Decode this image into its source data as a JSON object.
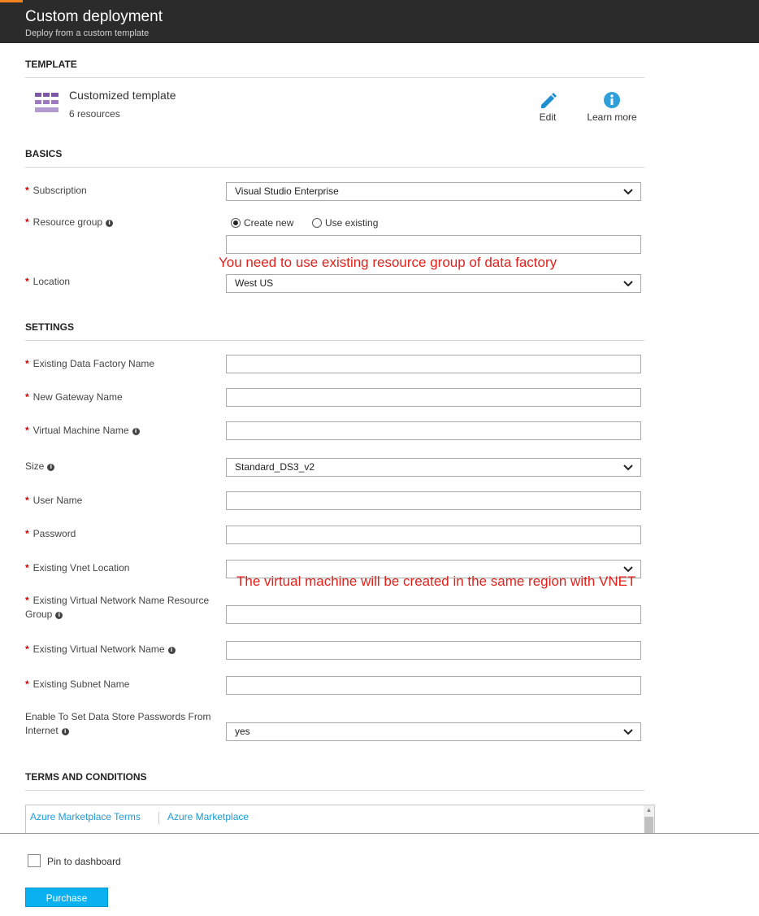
{
  "header": {
    "title": "Custom deployment",
    "subtitle": "Deploy from a custom template"
  },
  "template": {
    "section_title": "TEMPLATE",
    "name": "Customized template",
    "resources": "6 resources",
    "edit_label": "Edit",
    "learn_more_label": "Learn more"
  },
  "basics": {
    "section_title": "BASICS",
    "subscription": {
      "label": "Subscription",
      "value": "Visual Studio Enterprise"
    },
    "resource_group": {
      "label": "Resource group",
      "option_create": "Create new",
      "option_existing": "Use existing",
      "selected": "Create new",
      "value": ""
    },
    "annotation": "You need to use existing resource group of data factory",
    "location": {
      "label": "Location",
      "value": "West US"
    }
  },
  "settings": {
    "section_title": "SETTINGS",
    "data_factory_name": {
      "label": "Existing Data Factory Name",
      "value": ""
    },
    "gateway_name": {
      "label": "New Gateway Name",
      "value": ""
    },
    "vm_name": {
      "label": "Virtual Machine Name",
      "value": ""
    },
    "size": {
      "label": "Size",
      "value": "Standard_DS3_v2"
    },
    "user_name": {
      "label": "User Name",
      "value": ""
    },
    "password": {
      "label": "Password",
      "value": ""
    },
    "vnet_location": {
      "label": "Existing Vnet Location",
      "value": ""
    },
    "annotation": "The virtual machine will be created in the same region with VNET",
    "vnet_rg": {
      "label_line1": "Existing Virtual Network Name Resource",
      "label_line2": "Group",
      "value": ""
    },
    "vnet_name": {
      "label": "Existing Virtual Network Name",
      "value": ""
    },
    "subnet_name": {
      "label": "Existing Subnet Name",
      "value": ""
    },
    "data_store": {
      "label_line1": "Enable To Set Data Store Passwords From",
      "label_line2": "Internet",
      "value": "yes"
    }
  },
  "terms": {
    "section_title": "TERMS AND CONDITIONS",
    "link1": "Azure Marketplace Terms",
    "link2": "Azure Marketplace"
  },
  "footer": {
    "pin_label": "Pin to dashboard",
    "pinned": false,
    "purchase_label": "Purchase"
  },
  "colors": {
    "header_bg": "#2b2b2b",
    "accent": "#f58220",
    "annotation": "#e0211b",
    "link": "#1a9bd7",
    "purchase": "#0ab1f0",
    "required": "#cc0000"
  },
  "icons": [
    "template-grid-icon",
    "pencil-icon",
    "info-circle-icon",
    "chevron-down-icon",
    "info-icon"
  ]
}
